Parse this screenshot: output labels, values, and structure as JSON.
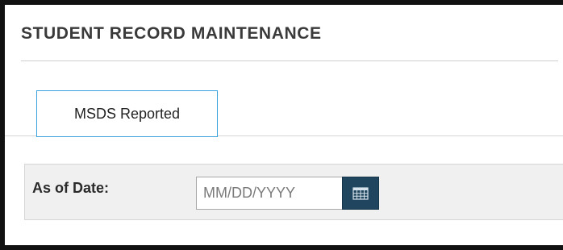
{
  "page": {
    "title": "STUDENT RECORD MAINTENANCE"
  },
  "tabs": [
    {
      "label": "MSDS Reported",
      "active": true
    }
  ],
  "filter": {
    "as_of_date_label": "As of Date:",
    "as_of_date_placeholder": "MM/DD/YYYY",
    "as_of_date_value": ""
  },
  "icons": {
    "calendar": "calendar-icon"
  },
  "colors": {
    "active_tab_border": "#3aa3dd",
    "calendar_button_bg": "#20465f",
    "panel_bg": "#f0f0f0",
    "title_text": "#3a3a3a"
  }
}
